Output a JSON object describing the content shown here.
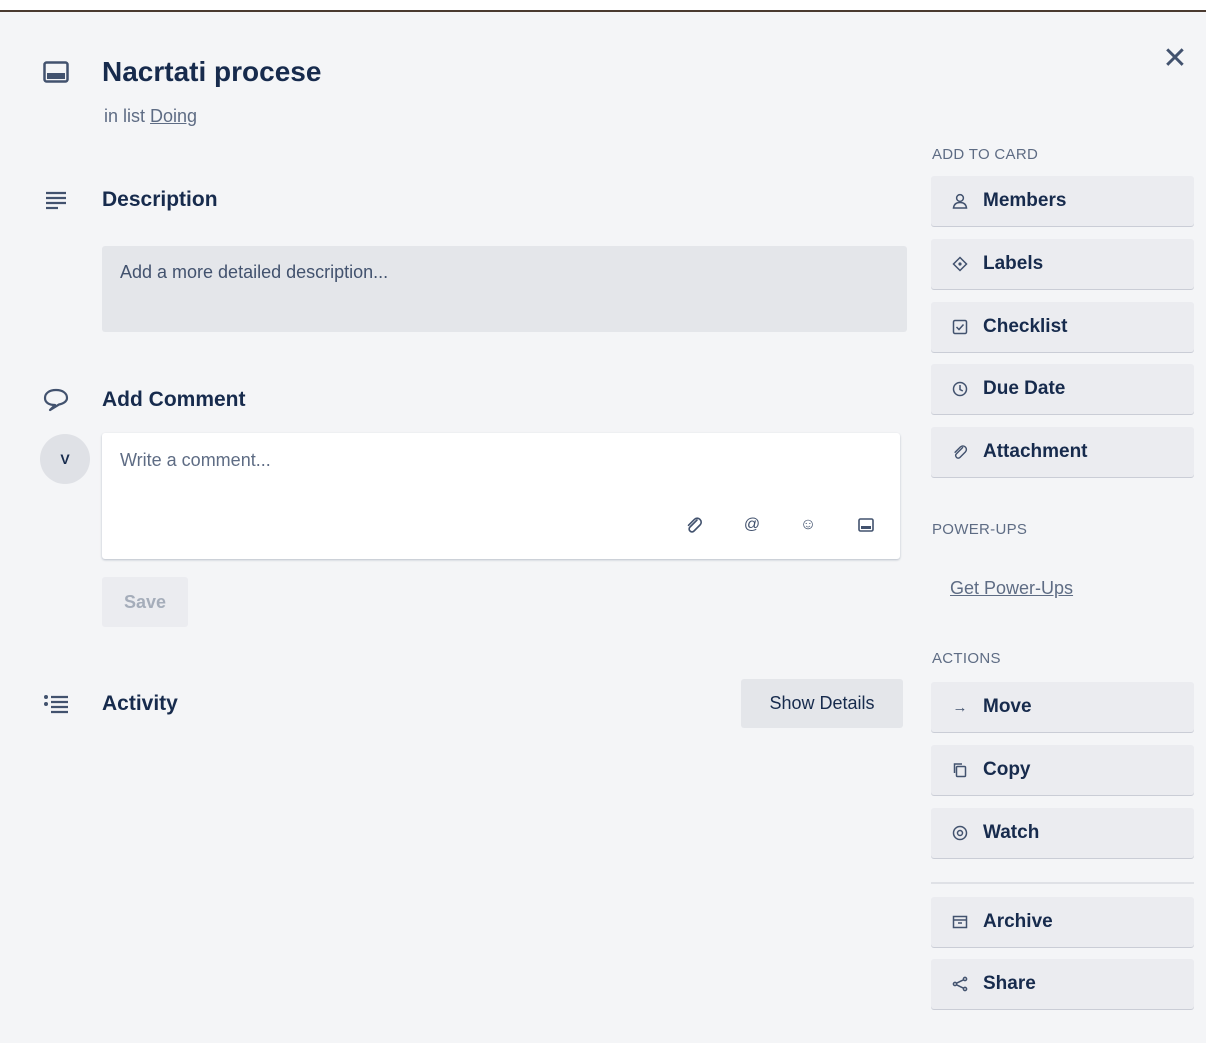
{
  "card": {
    "title": "Nacrtati procese",
    "in_list_prefix": "in list",
    "list_name": "Doing",
    "title_icon": "card-icon",
    "close_icon": "close-icon"
  },
  "description": {
    "heading": "Description",
    "placeholder": "Add a more detailed description..."
  },
  "comment": {
    "heading": "Add Comment",
    "avatar_initial": "V",
    "placeholder": "Write a comment...",
    "save_label": "Save",
    "tool_icons": [
      "paperclip-icon",
      "at-mention-icon",
      "emoji-icon",
      "card-icon"
    ]
  },
  "activity": {
    "heading": "Activity",
    "show_details_label": "Show Details"
  },
  "sidebar": {
    "add_to_card_label": "ADD TO CARD",
    "add_to_card": [
      {
        "label": "Members",
        "icon": "person-icon"
      },
      {
        "label": "Labels",
        "icon": "tag-icon"
      },
      {
        "label": "Checklist",
        "icon": "checklist-icon"
      },
      {
        "label": "Due Date",
        "icon": "clock-icon"
      },
      {
        "label": "Attachment",
        "icon": "paperclip-icon"
      }
    ],
    "power_ups_label": "POWER-UPS",
    "get_power_ups": "Get Power-Ups",
    "actions_label": "ACTIONS",
    "actions": [
      {
        "label": "Move",
        "icon": "arrow-right-icon"
      },
      {
        "label": "Copy",
        "icon": "copy-icon"
      },
      {
        "label": "Watch",
        "icon": "eye-icon"
      },
      {
        "label": "Archive",
        "icon": "archive-icon"
      },
      {
        "label": "Share",
        "icon": "share-icon"
      }
    ]
  }
}
